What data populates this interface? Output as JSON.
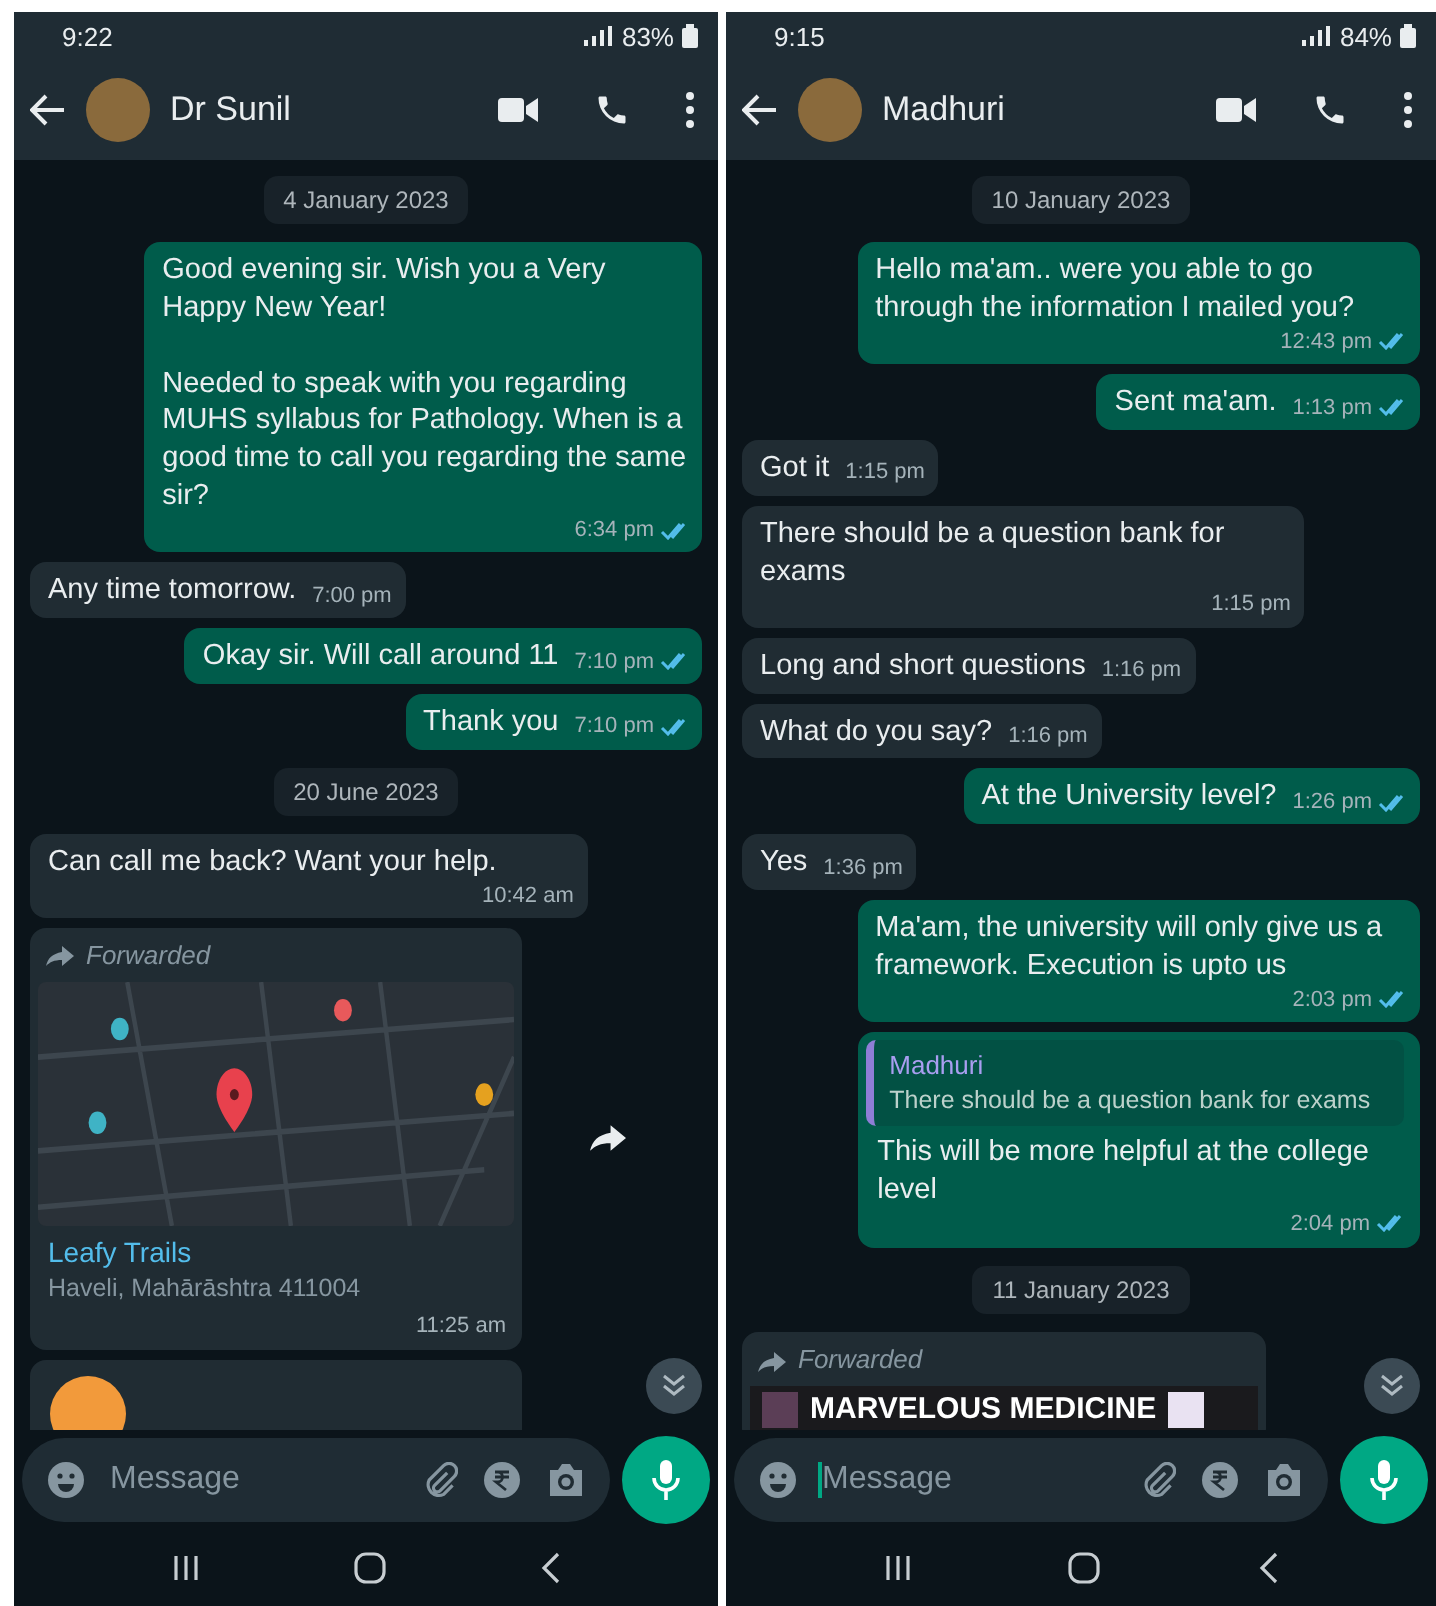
{
  "phones": [
    {
      "status_bar": {
        "time": "9:22",
        "battery": "83%"
      },
      "header": {
        "name": "Dr Sunil"
      },
      "messages": [
        {
          "kind": "date",
          "text": "4 January 2023"
        },
        {
          "kind": "out",
          "text": "Good evening sir. Wish you a Very Happy New Year!\n\nNeeded to speak with you regarding MUHS syllabus for Pathology. When is a good time to call you regarding the same sir?",
          "time": "6:34 pm",
          "read": true
        },
        {
          "kind": "in",
          "text": "Any time tomorrow.",
          "time": "7:00 pm"
        },
        {
          "kind": "out",
          "text": "Okay sir. Will call around 11",
          "time": "7:10 pm",
          "read": true
        },
        {
          "kind": "out",
          "text": "Thank you",
          "time": "7:10 pm",
          "read": true
        },
        {
          "kind": "date",
          "text": "20 June 2023"
        },
        {
          "kind": "in",
          "text": "Can call me back? Want your help.",
          "time": "10:42 am"
        },
        {
          "kind": "location",
          "forwarded": "Forwarded",
          "title": "Leafy Trails",
          "text": "Haveli, Mahārāshtra 411004",
          "time": "11:25 am"
        },
        {
          "kind": "contact"
        }
      ],
      "composer": {
        "placeholder": "Message",
        "focused": false
      }
    },
    {
      "status_bar": {
        "time": "9:15",
        "battery": "84%"
      },
      "header": {
        "name": "Madhuri"
      },
      "messages": [
        {
          "kind": "date",
          "text": "10 January 2023"
        },
        {
          "kind": "out",
          "text": "Hello ma'am.. were you able to go through the information I mailed you?",
          "time": "12:43 pm",
          "read": true
        },
        {
          "kind": "out",
          "text": "Sent ma'am.",
          "time": "1:13 pm",
          "read": true
        },
        {
          "kind": "in",
          "text": "Got it",
          "time": "1:15 pm"
        },
        {
          "kind": "in",
          "text": "There should be a question bank for exams",
          "time": "1:15 pm"
        },
        {
          "kind": "in",
          "text": "Long and short questions",
          "time": "1:16 pm"
        },
        {
          "kind": "in",
          "text": "What do you say?",
          "time": "1:16 pm"
        },
        {
          "kind": "out",
          "text": "At the University level?",
          "time": "1:26 pm",
          "read": true
        },
        {
          "kind": "in",
          "text": "Yes",
          "time": "1:36 pm"
        },
        {
          "kind": "out",
          "text": "Ma'am, the university will only give us a framework. Execution is upto us",
          "time": "2:03 pm",
          "read": true
        },
        {
          "kind": "reply",
          "quote_author": "Madhuri",
          "quote_text": "There should be a question bank for exams",
          "text": "This will be more helpful at the college level",
          "time": "2:04 pm",
          "read": true
        },
        {
          "kind": "date",
          "text": "11 January 2023"
        },
        {
          "kind": "preview",
          "forwarded": "Forwarded",
          "title": "MARVELOUS MEDICINE"
        }
      ],
      "composer": {
        "placeholder": "Message",
        "focused": true
      }
    }
  ]
}
